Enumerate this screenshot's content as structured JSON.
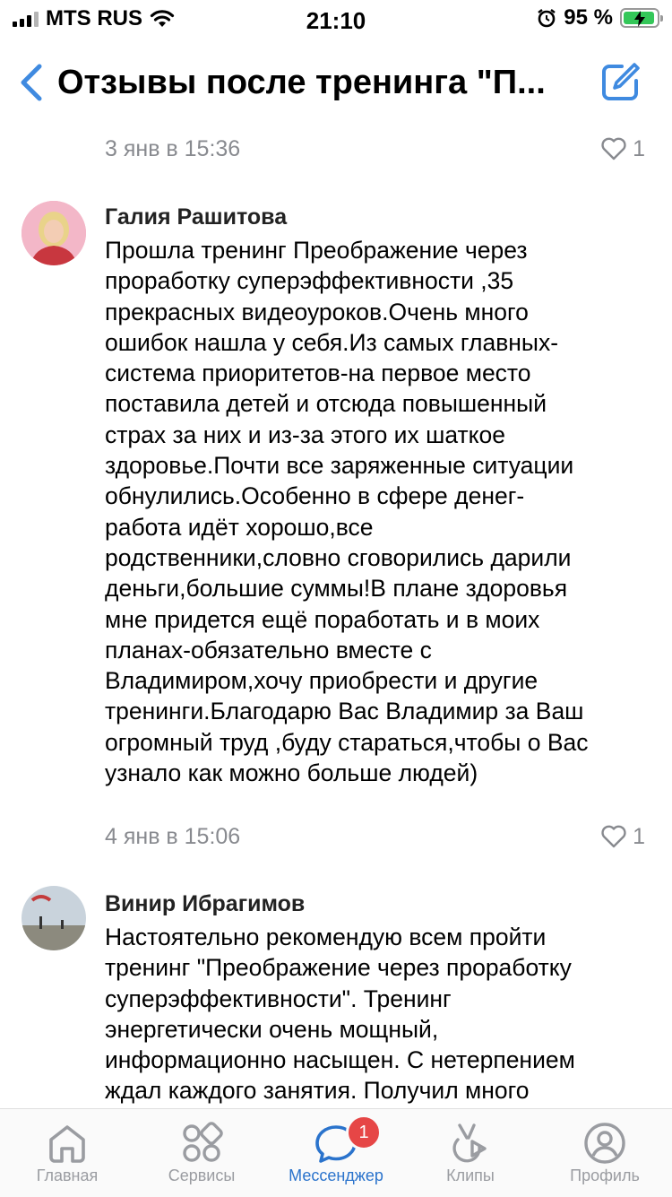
{
  "status_bar": {
    "carrier": "MTS RUS",
    "time": "21:10",
    "battery_percent": "95 %",
    "battery_level": 0.95
  },
  "header": {
    "title": "Отзывы после тренинга \"П...",
    "back_icon": "chevron-left-icon",
    "edit_icon": "compose-icon"
  },
  "top_meta": {
    "date": "3 янв в 15:36",
    "likes": "1"
  },
  "comments": [
    {
      "author": "Галия Рашитова",
      "text": "Прошла тренинг Преображение через\nпроработку суперэффективности ,35\nпрекрасных видеоуроков.Очень много\nошибок нашла у себя.Из самых главных-\nсистема приоритетов-на первое место\nпоставила детей и отсюда повышенный\nстрах за них и из-за этого их шаткое\nздоровье.Почти все заряженные ситуации\nобнулились.Особенно в сфере денег-\nработа идёт хорошо,все\nродственники,словно сговорились дарили\nденьги,большие суммы!В плане здоровья\nмне придется ещё поработать и в моих\nпланах-обязательно вместе с\nВладимиром,хочу приобрести и другие\nтренинги.Благодарю Вас Владимир за Ваш\nогромный труд ,буду стараться,чтобы о Вас\nузнало как можно больше людей)",
      "date": "4 янв в 15:06",
      "likes": "1"
    },
    {
      "author": "Винир Ибрагимов",
      "text": "Настоятельно рекомендую всем пройти\nтренинг \"Преображение через проработку\nсуперэффективности\". Тренинг\nэнергетически очень мощный,\nинформационно насыщен. С нетерпением\nждал каждого занятия. Получил много"
    }
  ],
  "tabs": [
    {
      "label": "Главная",
      "icon": "home-icon"
    },
    {
      "label": "Сервисы",
      "icon": "services-icon"
    },
    {
      "label": "Мессенджер",
      "icon": "messenger-icon",
      "badge": "1",
      "active": true
    },
    {
      "label": "Клипы",
      "icon": "clips-icon"
    },
    {
      "label": "Профиль",
      "icon": "profile-icon"
    }
  ],
  "colors": {
    "accent": "#2a73cc",
    "muted": "#888a8f",
    "badge": "#e64646"
  }
}
